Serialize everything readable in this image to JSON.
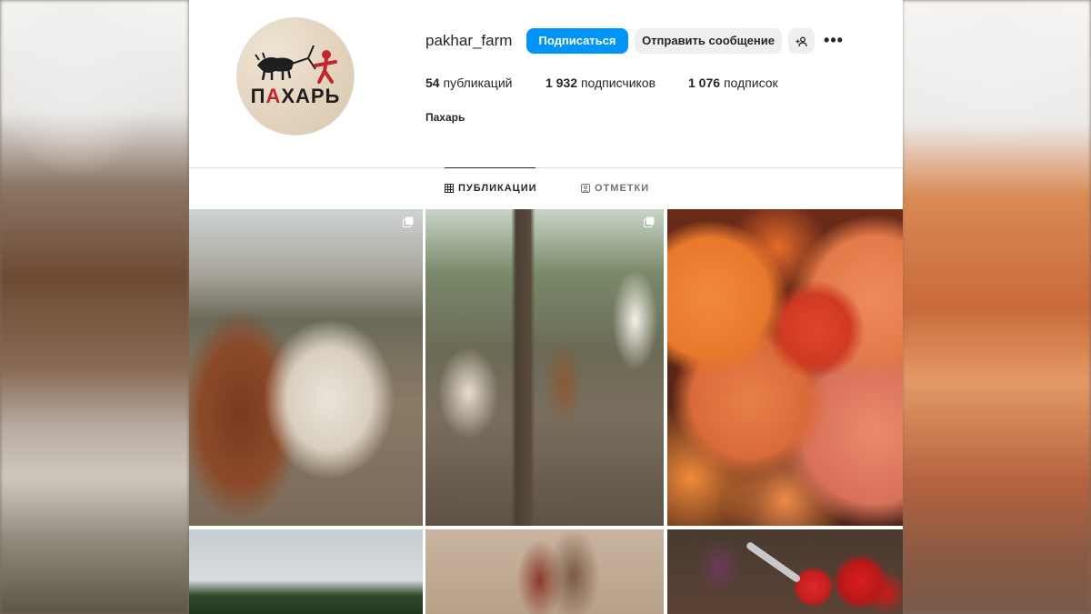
{
  "profile": {
    "username": "pakhar_farm",
    "full_name": "Пахарь",
    "avatar_text_black": "П",
    "avatar_text_red": "А",
    "avatar_text_black2": "ХАРЬ",
    "posts_count": "54",
    "posts_label": "публикаций",
    "followers_count": "1 932",
    "followers_label": "подписчиков",
    "following_count": "1 076",
    "following_label": "подписок"
  },
  "actions": {
    "follow_label": "Подписаться",
    "message_label": "Отправить сообщение",
    "more_label": "•••"
  },
  "tabs": [
    {
      "label": "ПУБЛИКАЦИИ",
      "icon": "grid-icon",
      "active": true
    },
    {
      "label": "ОТМЕТКИ",
      "icon": "tagged-icon",
      "active": false
    }
  ],
  "posts": [
    {
      "subject": "cow-closeup",
      "multi": true
    },
    {
      "subject": "cows-in-forest",
      "multi": true
    },
    {
      "subject": "pumpkins",
      "multi": false
    },
    {
      "subject": "field-sky",
      "multi": false
    },
    {
      "subject": "meat-board",
      "multi": false
    },
    {
      "subject": "tomatoes-knife",
      "multi": false
    }
  ],
  "colors": {
    "accent": "#0095f6",
    "text": "#262626",
    "muted": "#737373",
    "logo_red": "#c0272d"
  }
}
